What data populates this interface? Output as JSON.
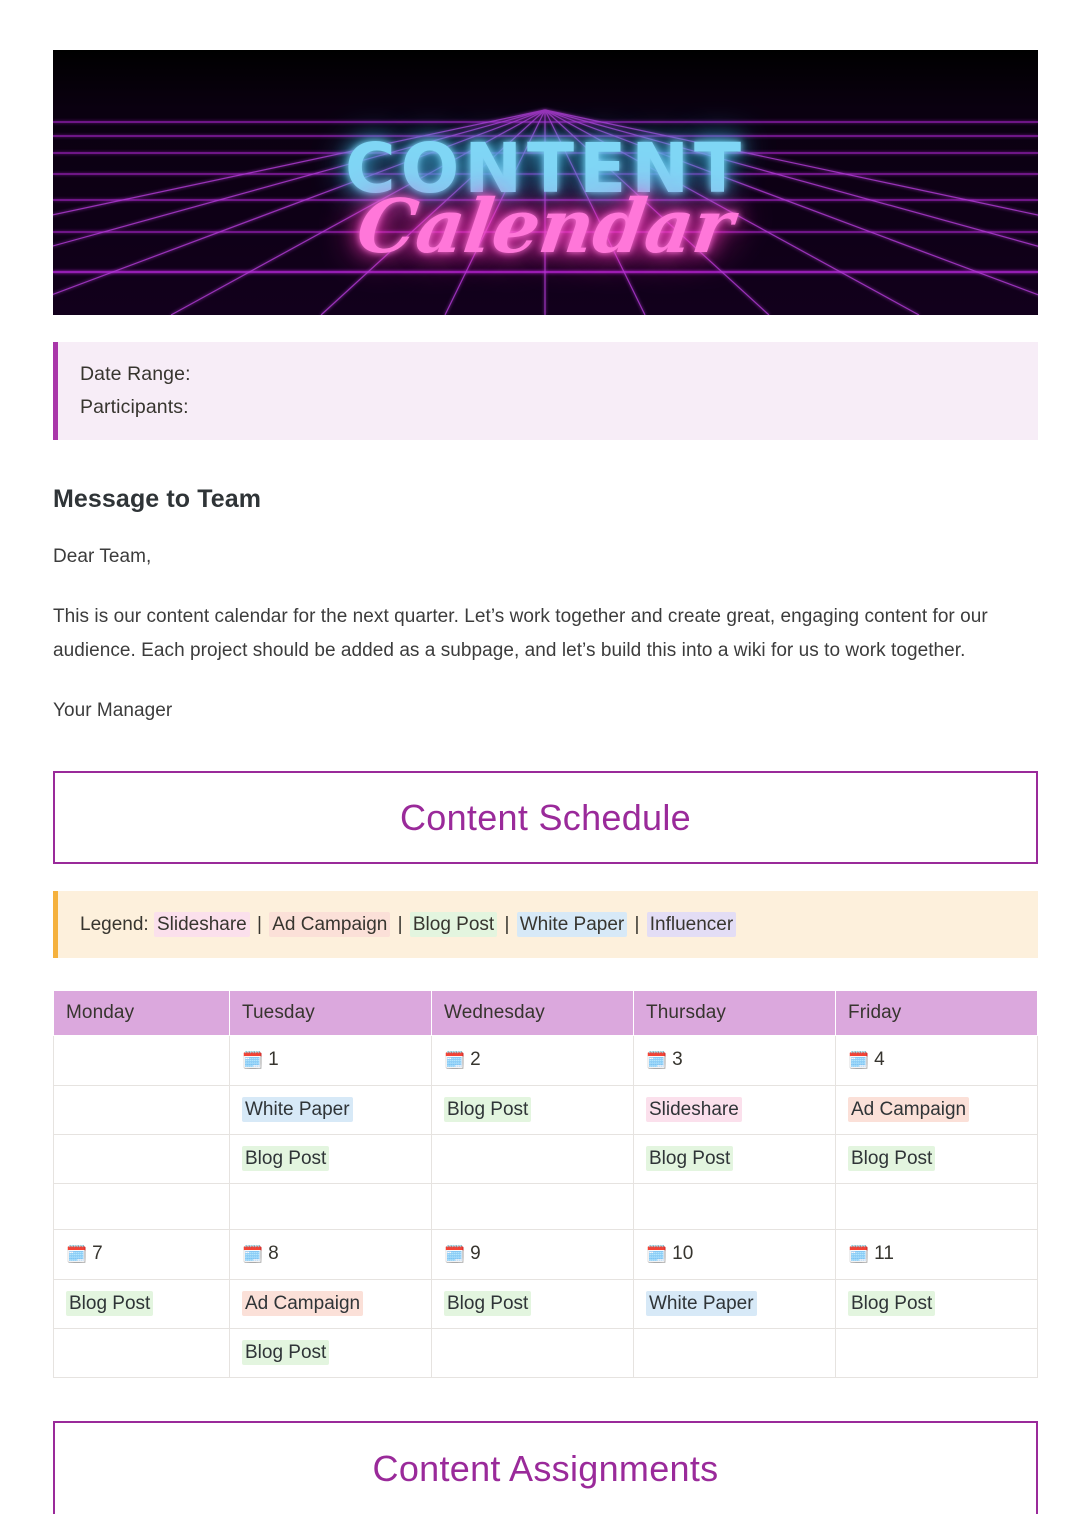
{
  "cover": {
    "title": "CONTENT",
    "subtitle": "Calendar",
    "title_color": "#7fd6f5",
    "subtitle_color": "#ff77d9",
    "background": "#000000",
    "grid_color": "#a020c0"
  },
  "info_callout": {
    "accent_color": "#a936a9",
    "background": "#f7edf7",
    "lines": [
      "Date Range:",
      "Participants:"
    ]
  },
  "message": {
    "heading": "Message to Team",
    "greeting": "Dear Team,",
    "body": "This is our content calendar for the next quarter. Let’s work together and create great, engaging content for our audience. Each project should be added as a subpage, and let’s build this into a wiki for us to work together.",
    "signature": "Your Manager"
  },
  "schedule_heading": {
    "text": "Content Schedule",
    "color": "#9a2a9a"
  },
  "legend": {
    "accent_color": "#f5b13d",
    "background": "#fdf0dc",
    "label": "Legend:",
    "separator": "|",
    "items": [
      {
        "label": "Slideshare",
        "color": "#fbe0ec",
        "key": "slideshare"
      },
      {
        "label": "Ad Campaign",
        "color": "#fbe0d8",
        "key": "ad"
      },
      {
        "label": "Blog Post",
        "color": "#e3f5df",
        "key": "blog"
      },
      {
        "label": "White Paper",
        "color": "#d7e9f7",
        "key": "white"
      },
      {
        "label": "Influencer",
        "color": "#e3ddf5",
        "key": "influencer"
      }
    ]
  },
  "calendar": {
    "header_background": "#dba8dd",
    "date_icon": "🗓️",
    "columns": [
      "Monday",
      "Tuesday",
      "Wednesday",
      "Thursday",
      "Friday"
    ],
    "weeks": [
      {
        "dates": [
          "",
          "1",
          "2",
          "3",
          "4"
        ],
        "rows": [
          [
            "",
            "White Paper",
            "Blog Post",
            "Slideshare",
            "Ad Campaign"
          ],
          [
            "",
            "Blog Post",
            "",
            "Blog Post",
            "Blog Post"
          ],
          [
            "",
            "",
            "",
            "",
            ""
          ]
        ]
      },
      {
        "dates": [
          "7",
          "8",
          "9",
          "10",
          "11"
        ],
        "rows": [
          [
            "Blog Post",
            "Ad Campaign",
            "Blog Post",
            "White Paper",
            "Blog Post"
          ],
          [
            "",
            "Blog Post",
            "",
            "",
            ""
          ]
        ]
      }
    ]
  },
  "assignments_heading": {
    "text": "Content Assignments",
    "color": "#9a2a9a"
  }
}
